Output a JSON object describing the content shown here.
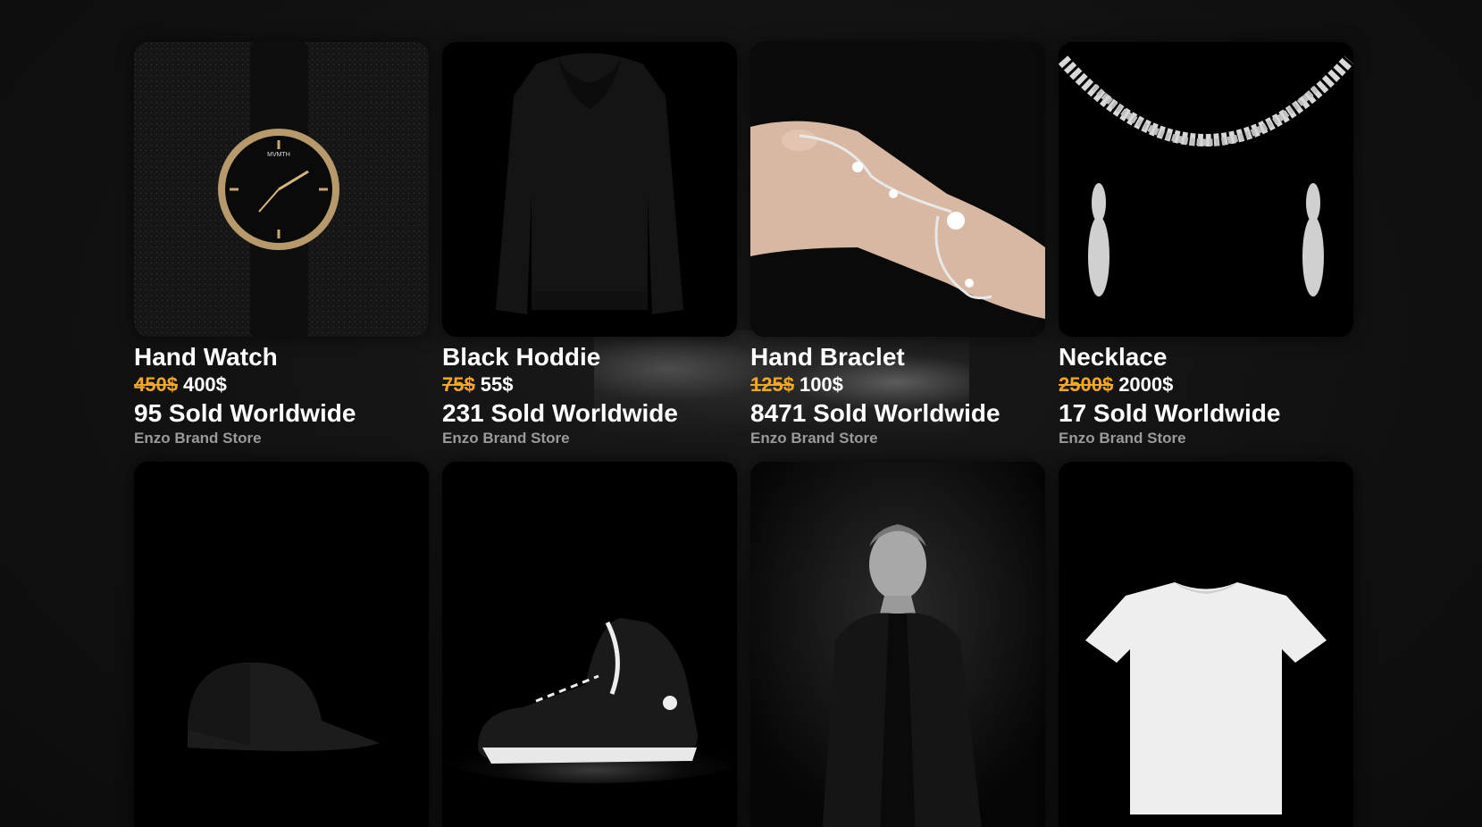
{
  "colors": {
    "background": "#121212",
    "old_price": "#f5a623",
    "text": "#ffffff",
    "store": "#9a9a9a"
  },
  "products": [
    {
      "title": "Hand Watch",
      "old_price": "450$",
      "new_price": "400$",
      "sold": "95 Sold Worldwide",
      "store": "Enzo Brand Store",
      "image_icon": "watch-image"
    },
    {
      "title": "Black Hoddie",
      "old_price": "75$",
      "new_price": "55$",
      "sold": "231 Sold Worldwide",
      "store": "Enzo Brand Store",
      "image_icon": "hoodie-image"
    },
    {
      "title": "Hand Braclet",
      "old_price": "125$",
      "new_price": "100$",
      "sold": "8471 Sold Worldwide",
      "store": "Enzo Brand Store",
      "image_icon": "bracelet-image"
    },
    {
      "title": "Necklace",
      "old_price": "2500$",
      "new_price": "2000$",
      "sold": "17 Sold Worldwide",
      "store": "Enzo Brand Store",
      "image_icon": "necklace-image"
    }
  ],
  "products_row2": [
    {
      "image_icon": "cap-image"
    },
    {
      "image_icon": "sneaker-image"
    },
    {
      "image_icon": "suit-model-image"
    },
    {
      "image_icon": "tshirt-image"
    }
  ]
}
